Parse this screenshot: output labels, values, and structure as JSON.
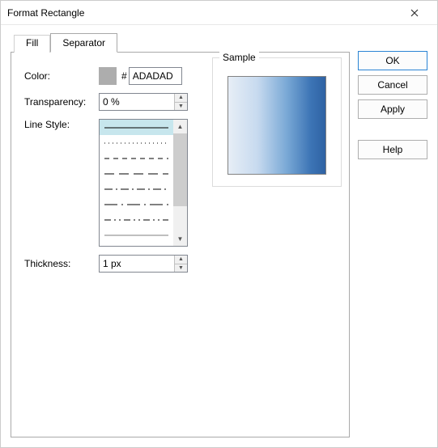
{
  "window": {
    "title": "Format Rectangle"
  },
  "tabs": {
    "fill": "Fill",
    "separator": "Separator"
  },
  "labels": {
    "color": "Color:",
    "transparency": "Transparency:",
    "linestyle": "Line Style:",
    "thickness": "Thickness:",
    "sample": "Sample"
  },
  "values": {
    "color_hex": "ADADAD",
    "color_swatch": "#ADADAD",
    "transparency": "0 %",
    "thickness": "1 px"
  },
  "buttons": {
    "ok": "OK",
    "cancel": "Cancel",
    "apply": "Apply",
    "help": "Help"
  },
  "hash": "#"
}
